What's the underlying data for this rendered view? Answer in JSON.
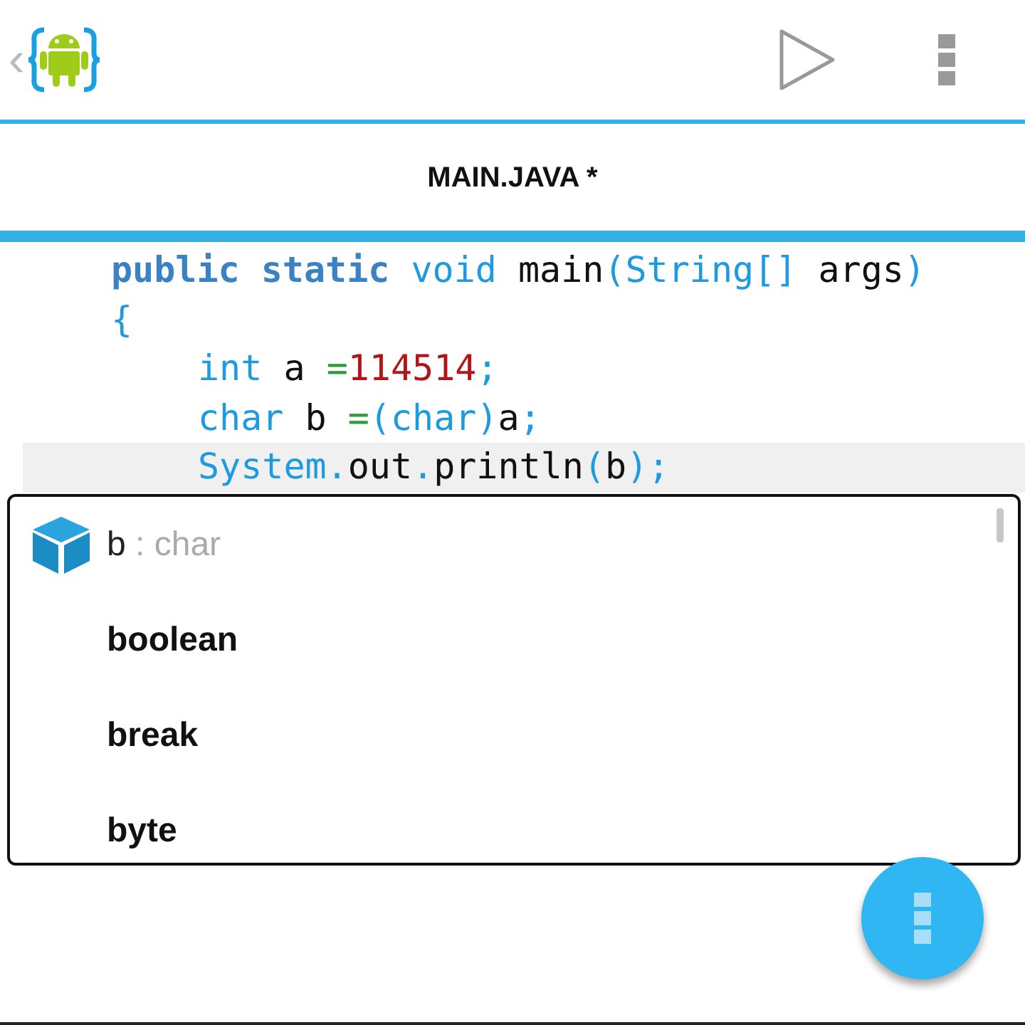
{
  "toolbar": {
    "back_glyph": "‹",
    "actions": [
      {
        "kind": "run"
      },
      {
        "kind": "overflow"
      }
    ]
  },
  "tab": {
    "title": "MAIN.JAVA *"
  },
  "code": {
    "lines": [
      {
        "current": false,
        "tokens": [
          {
            "kind": "keyword",
            "text": "public static"
          },
          {
            "kind": "type",
            "text": " void"
          },
          {
            "kind": "plain",
            "text": " main"
          },
          {
            "kind": "punct",
            "text": "(String[]"
          },
          {
            "kind": "plain",
            "text": " args"
          },
          {
            "kind": "punct",
            "text": ")"
          }
        ]
      },
      {
        "current": false,
        "tokens": [
          {
            "kind": "punct",
            "text": "{"
          }
        ],
        "children": [
          {
            "current": false,
            "tokens": [
              {
                "kind": "type",
                "text": "int"
              },
              {
                "kind": "plain",
                "text": " a "
              },
              {
                "kind": "operator",
                "text": "="
              },
              {
                "kind": "number",
                "text": "114514"
              },
              {
                "kind": "punct",
                "text": ";"
              }
            ]
          },
          {
            "current": false,
            "tokens": [
              {
                "kind": "type",
                "text": "char"
              },
              {
                "kind": "plain",
                "text": " b "
              },
              {
                "kind": "operator",
                "text": "="
              },
              {
                "kind": "punct",
                "text": "(char)"
              },
              {
                "kind": "plain",
                "text": "a"
              },
              {
                "kind": "punct",
                "text": ";"
              }
            ]
          },
          {
            "current": true,
            "tokens": [
              {
                "kind": "type",
                "text": "System."
              },
              {
                "kind": "plain",
                "text": "out"
              },
              {
                "kind": "punct",
                "text": "."
              },
              {
                "kind": "plain",
                "text": "println"
              },
              {
                "kind": "punct",
                "text": "("
              },
              {
                "kind": "plain",
                "text": "b"
              },
              {
                "kind": "punct",
                "text": ");"
              }
            ]
          }
        ]
      }
    ]
  },
  "completions": [
    {
      "kind": "variable",
      "name": "b",
      "detail": " : char"
    },
    {
      "kind": "keyword",
      "name": "boolean"
    },
    {
      "kind": "keyword",
      "name": "break"
    },
    {
      "kind": "keyword",
      "name": "byte"
    }
  ]
}
